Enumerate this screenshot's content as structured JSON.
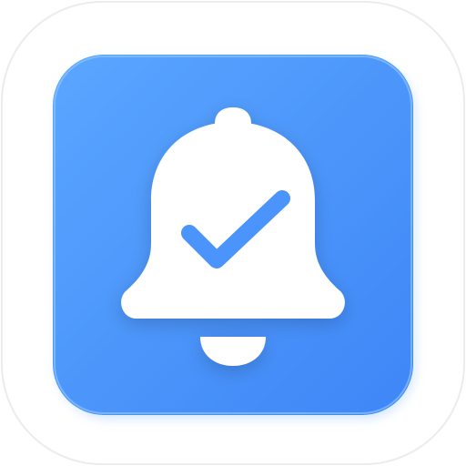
{
  "icon": {
    "name": "notification-check-app-icon",
    "outer_tile_color": "#ffffff",
    "outer_tile_border": "#ececef",
    "tile_gradient_start": "#5aa6ff",
    "tile_gradient_end": "#3e86f7",
    "symbol_color": "#ffffff",
    "check_color": "#4a94fb",
    "symbol": "bell-with-checkmark"
  }
}
